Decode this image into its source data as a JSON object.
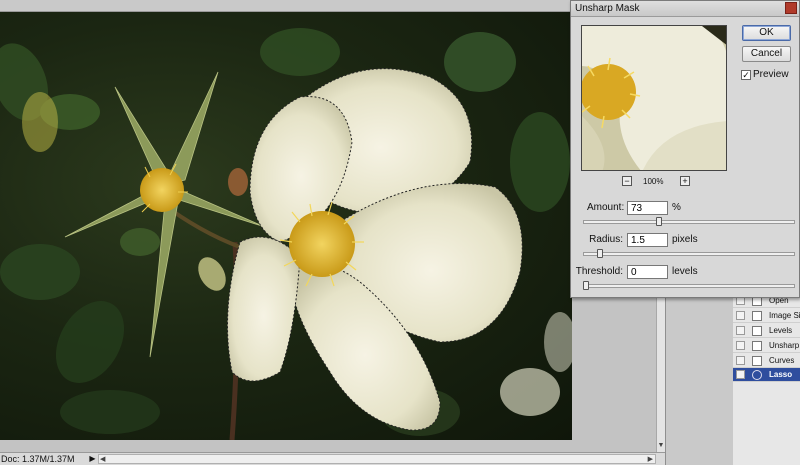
{
  "status": {
    "doc_info": "Doc: 1.37M/1.37M",
    "arrow": "▶"
  },
  "dialog": {
    "title": "Unsharp Mask",
    "ok_label": "OK",
    "cancel_label": "Cancel",
    "preview_label": "Preview",
    "preview_checked": true,
    "check_glyph": "✓",
    "zoom_level": "100%",
    "zoom_minus": "−",
    "zoom_plus": "+",
    "params": [
      {
        "label": "Amount:",
        "value": "73",
        "unit": "%",
        "slider": 0.36
      },
      {
        "label": "Radius:",
        "value": "1.5",
        "unit": "pixels",
        "slider": 0.07
      },
      {
        "label": "Threshold:",
        "value": "0",
        "unit": "levels",
        "slider": 0.0
      }
    ]
  },
  "history": {
    "items": [
      {
        "label": "Open",
        "selected": false
      },
      {
        "label": "Image Size",
        "selected": false
      },
      {
        "label": "Levels",
        "selected": false
      },
      {
        "label": "Unsharp Mask",
        "selected": false
      },
      {
        "label": "Curves",
        "selected": false
      },
      {
        "label": "Lasso",
        "selected": true
      }
    ]
  },
  "colors": {
    "selection_blue": "#2f4e9e",
    "petal": "#efeedc",
    "stamen": "#e2bb2a",
    "foliage": "#1c2a12"
  }
}
